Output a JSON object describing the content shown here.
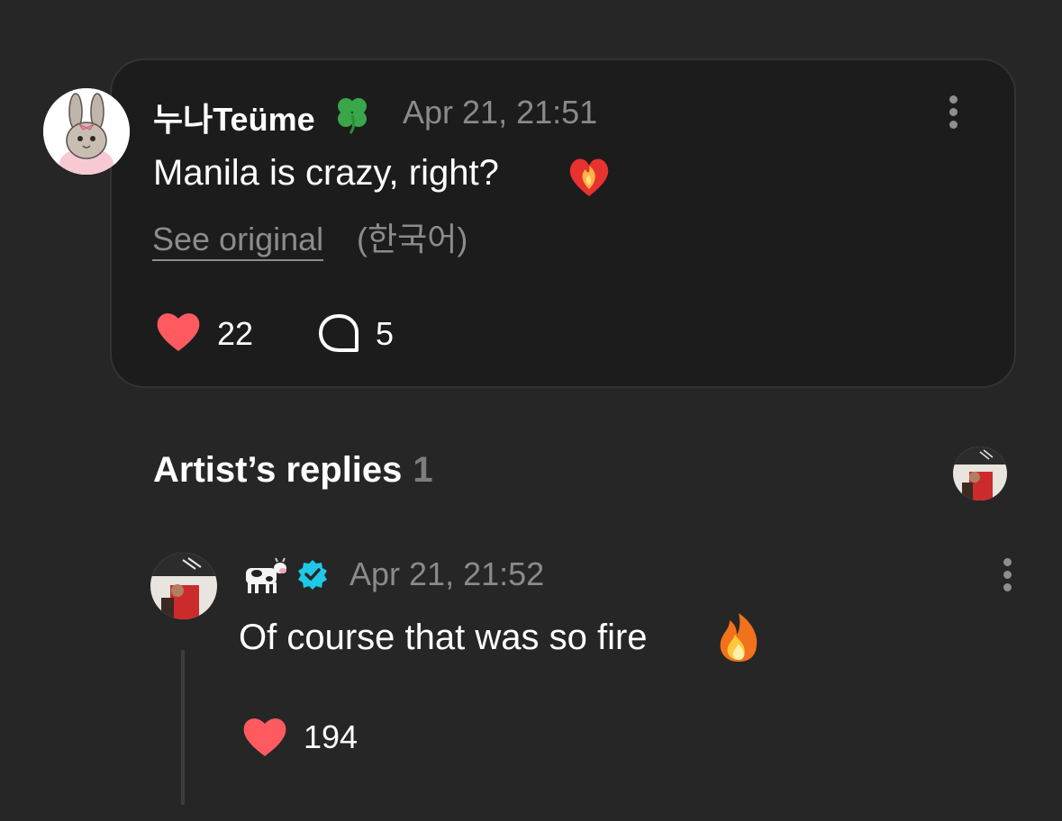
{
  "comment": {
    "author": "누나Teüme",
    "author_emoji_icon": "four-leaf-clover-icon",
    "timestamp": "Apr 21, 21:51",
    "text": "Manila is crazy, right?",
    "text_emoji_icon": "heart-on-fire-icon",
    "see_original_label": "See original",
    "original_language": "(한국어)",
    "like_count": "22",
    "reply_count": "5"
  },
  "artist_replies": {
    "title": "Artist’s replies",
    "count": "1"
  },
  "reply": {
    "author_emoji_icon": "cow-icon",
    "verified_icon": "verified-badge-icon",
    "timestamp": "Apr 21, 21:52",
    "text": "Of course that was so fire",
    "text_emoji_icon": "fire-icon",
    "like_count": "194"
  },
  "colors": {
    "background": "#262626",
    "card": "#1c1c1c",
    "like_heart": "#ff5a5f",
    "verified": "#1ec8e6",
    "muted_text": "#8a8a8a"
  }
}
